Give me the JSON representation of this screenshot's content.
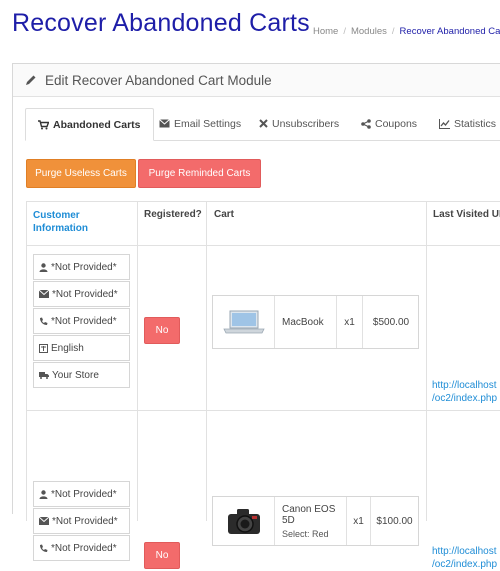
{
  "page": {
    "title": "Recover Abandoned Carts",
    "breadcrumb": [
      "Home",
      "Modules",
      "Recover Abandoned Carts"
    ]
  },
  "panel": {
    "heading": "Edit Recover Abandoned Cart Module",
    "heading_icon": "pencil-icon"
  },
  "tabs": [
    {
      "label": "Abandoned Carts",
      "icon": "cart-icon",
      "active": true
    },
    {
      "label": "Email Settings",
      "icon": "envelope-icon"
    },
    {
      "label": "Unsubscribers",
      "icon": "times-icon"
    },
    {
      "label": "Coupons",
      "icon": "share-icon"
    },
    {
      "label": "Statistics",
      "icon": "line-chart-icon"
    }
  ],
  "actions": {
    "purge_useless": "Purge Useless Carts",
    "purge_reminded": "Purge Reminded Carts"
  },
  "table": {
    "headers": [
      "Customer Information",
      "Registered?",
      "Cart",
      "Last Visited URL"
    ],
    "rows": [
      {
        "customer": [
          "*Not Provided*",
          "*Not Provided*",
          "*Not Provided*",
          "English",
          "Your Store"
        ],
        "registered": "No",
        "cart": [
          {
            "name": "MacBook",
            "option": "",
            "qty": "x1",
            "price": "$500.00"
          }
        ],
        "url": [
          "http://localhost",
          "/oc2/index.php"
        ]
      },
      {
        "customer": [
          "*Not Provided*",
          "*Not Provided*",
          "*Not Provided*"
        ],
        "registered": "No",
        "cart": [
          {
            "name": "Canon EOS 5D",
            "option": "Select: Red",
            "qty": "x1",
            "price": "$100.00"
          }
        ],
        "url": [
          "http://localhost",
          "/oc2/index.php"
        ]
      }
    ]
  },
  "colors": {
    "title": "#1e1ea8",
    "link": "#1f8dd6",
    "orange_button": "#f0913a",
    "red_button": "#f36b6b"
  }
}
